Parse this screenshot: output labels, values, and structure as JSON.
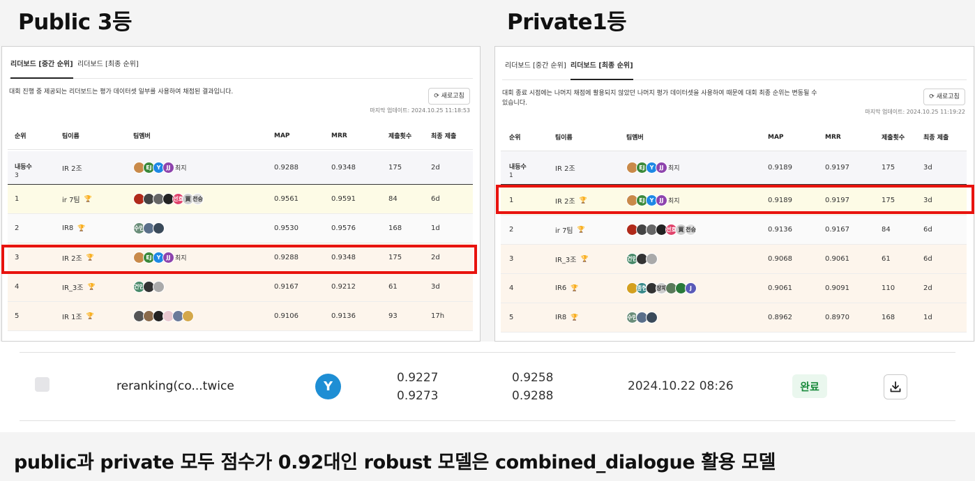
{
  "headings": {
    "left": "Public 3등",
    "right": "Private1등"
  },
  "left_panel": {
    "tabs": [
      "리더보드 [중간 순위]",
      "리더보드 [최종 순위]"
    ],
    "active_tab": 0,
    "description": "대회 진행 중 제공되는 리더보드는 평가 데이터셋 일부를 사용하여 채점된 결과입니다.",
    "refresh_label": "새로고침",
    "updated": "마지막 업데이트: 2024.10.25 11:18:53",
    "columns": [
      "순위",
      "팀이름",
      "팀멤버",
      "MAP",
      "MRR",
      "제출횟수",
      "최종 제출"
    ],
    "my_row": {
      "rank_label": "내등수",
      "rank": "3",
      "team": "IR 2조",
      "map": "0.9288",
      "mrr": "0.9348",
      "count": "175",
      "last": "2d"
    },
    "rows": [
      {
        "rank": "1",
        "team": "ir 7팀",
        "map": "0.9561",
        "mrr": "0.9591",
        "count": "84",
        "last": "6d",
        "tier": "gold"
      },
      {
        "rank": "2",
        "team": "IR8",
        "map": "0.9530",
        "mrr": "0.9576",
        "count": "168",
        "last": "1d",
        "tier": "silver"
      },
      {
        "rank": "3",
        "team": "IR 2조",
        "map": "0.9288",
        "mrr": "0.9348",
        "count": "175",
        "last": "2d",
        "tier": "bronze"
      },
      {
        "rank": "4",
        "team": "IR_3조",
        "map": "0.9167",
        "mrr": "0.9212",
        "count": "61",
        "last": "3d",
        "tier": "bronze"
      },
      {
        "rank": "5",
        "team": "IR 1조",
        "map": "0.9106",
        "mrr": "0.9136",
        "count": "93",
        "last": "17h",
        "tier": "bronze"
      }
    ]
  },
  "right_panel": {
    "tabs": [
      "리더보드 [중간 순위]",
      "리더보드 [최종 순위]"
    ],
    "active_tab": 1,
    "description_line1": "대회 종료 시점에는 나머지 채점에 활용되지 않았던 나머지 평가 데이터셋을 사용하여 때문에 대회 최종 순위는 변동될 수",
    "description_line2": "있습니다.",
    "refresh_label": "새로고침",
    "updated": "마지막 업데이트: 2024.10.25 11:19:22",
    "columns": [
      "순위",
      "팀이름",
      "팀멤버",
      "MAP",
      "MRR",
      "제출횟수",
      "최종 제출"
    ],
    "my_row": {
      "rank_label": "내등수",
      "rank": "1",
      "team": "IR 2조",
      "map": "0.9189",
      "mrr": "0.9197",
      "count": "175",
      "last": "3d"
    },
    "rows": [
      {
        "rank": "1",
        "team": "IR 2조",
        "map": "0.9189",
        "mrr": "0.9197",
        "count": "175",
        "last": "3d",
        "tier": "gold"
      },
      {
        "rank": "2",
        "team": "ir 7팀",
        "map": "0.9136",
        "mrr": "0.9167",
        "count": "84",
        "last": "6d",
        "tier": "silver"
      },
      {
        "rank": "3",
        "team": "IR_3조",
        "map": "0.9068",
        "mrr": "0.9061",
        "count": "61",
        "last": "6d",
        "tier": "bronze"
      },
      {
        "rank": "4",
        "team": "IR6",
        "map": "0.9061",
        "mrr": "0.9091",
        "count": "110",
        "last": "2d",
        "tier": "bronze"
      },
      {
        "rank": "5",
        "team": "IR8",
        "map": "0.8962",
        "mrr": "0.8970",
        "count": "168",
        "last": "1d",
        "tier": "bronze"
      }
    ]
  },
  "member_text": {
    "choiji": "최지",
    "jeonseung": "전승",
    "seonho": "선호",
    "sumin": "수민",
    "geonmin": "건민",
    "jonghyeon": "종현",
    "jangjae": "장재",
    "e": "EJ",
    "y": "Y",
    "jj": "JJ",
    "j": "J",
    "kanji": "買"
  },
  "submission": {
    "name": "reranking(co...twice",
    "avatar_letter": "Y",
    "public_map": "0.9227",
    "private_map": "0.9273",
    "public_mrr": "0.9258",
    "private_mrr": "0.9288",
    "date": "2024.10.22 08:26",
    "status": "완료"
  },
  "caption": "public과 private 모두 점수가 0.92대인 robust 모델은 combined_dialogue 활용 모델",
  "colors": {
    "highlight": "#e8130e",
    "trophy": "#e08a00",
    "status_green": "#1a8a3c",
    "avatar_blue": "#1e8ed4"
  },
  "icons": [
    "refresh-icon",
    "trophy-icon",
    "download-icon",
    "checkbox"
  ]
}
